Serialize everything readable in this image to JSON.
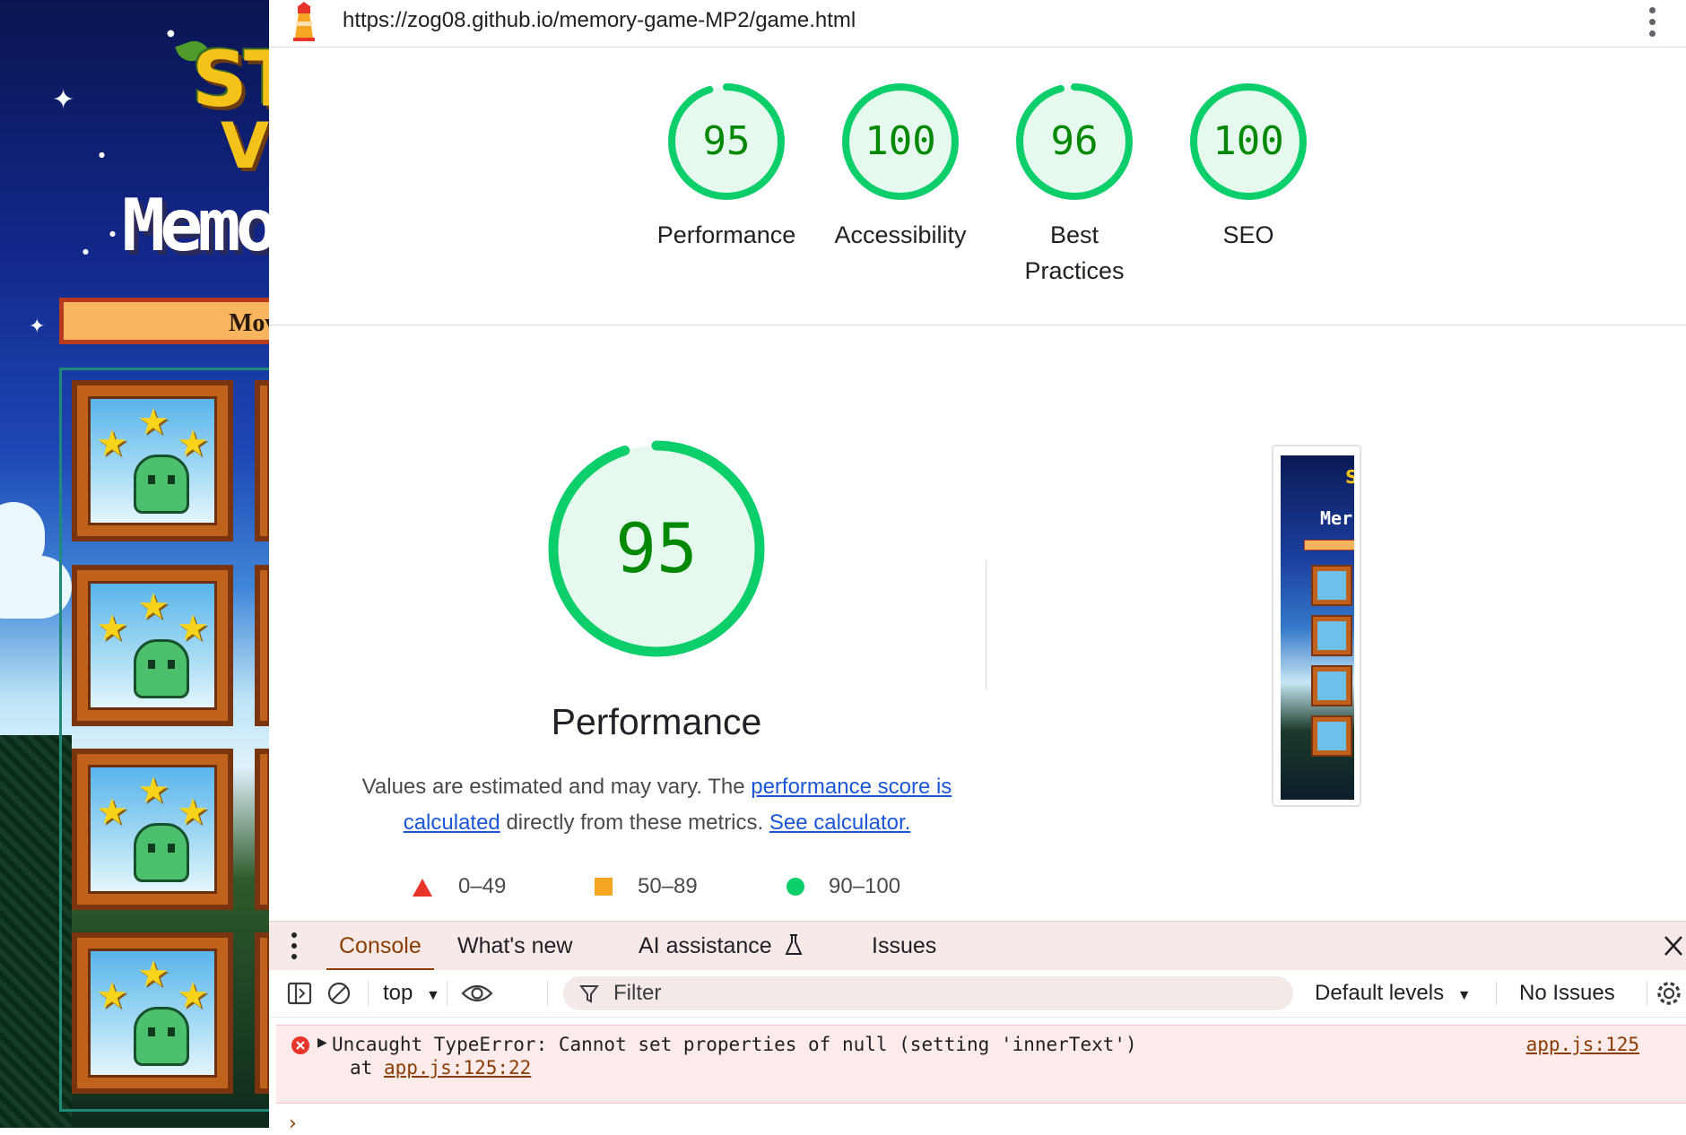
{
  "browser": {
    "url": "https://zog08.github.io/memory-game-MP2/game.html"
  },
  "game_page": {
    "logo_line1": "ST",
    "logo_line2": "V",
    "title_fragment": "Memo",
    "moves_fragment": "Mov"
  },
  "lighthouse": {
    "colors": {
      "pass": "#0cce6b",
      "pass_text": "#008800",
      "average": "#f5a623",
      "fail": "#e8352b"
    },
    "scores": [
      {
        "label": "Performance",
        "value": 95
      },
      {
        "label": "Accessibility",
        "value": 100
      },
      {
        "label": "Best Practices",
        "value": 96
      },
      {
        "label": "SEO",
        "value": 100
      }
    ],
    "detail": {
      "score": 95,
      "title": "Performance",
      "desc_prefix": "Values are estimated and may vary. The ",
      "link1": "performance score is calculated",
      "desc_middle": " directly from these metrics. ",
      "link2": "See calculator."
    },
    "legend": [
      {
        "range": "0–49",
        "icon": "triangle"
      },
      {
        "range": "50–89",
        "icon": "square"
      },
      {
        "range": "90–100",
        "icon": "circle"
      }
    ]
  },
  "devtools": {
    "tabs": [
      "Console",
      "What's new",
      "AI assistance",
      "Issues"
    ],
    "active_tab": "Console",
    "context": "top",
    "filter_placeholder": "Filter",
    "levels": "Default levels",
    "issues": "No Issues",
    "error": {
      "message": "Uncaught TypeError: Cannot set properties of null (setting 'innerText')",
      "at_prefix": "at ",
      "at_link": "app.js:125:22",
      "source": "app.js:125"
    },
    "prompt": "›"
  }
}
